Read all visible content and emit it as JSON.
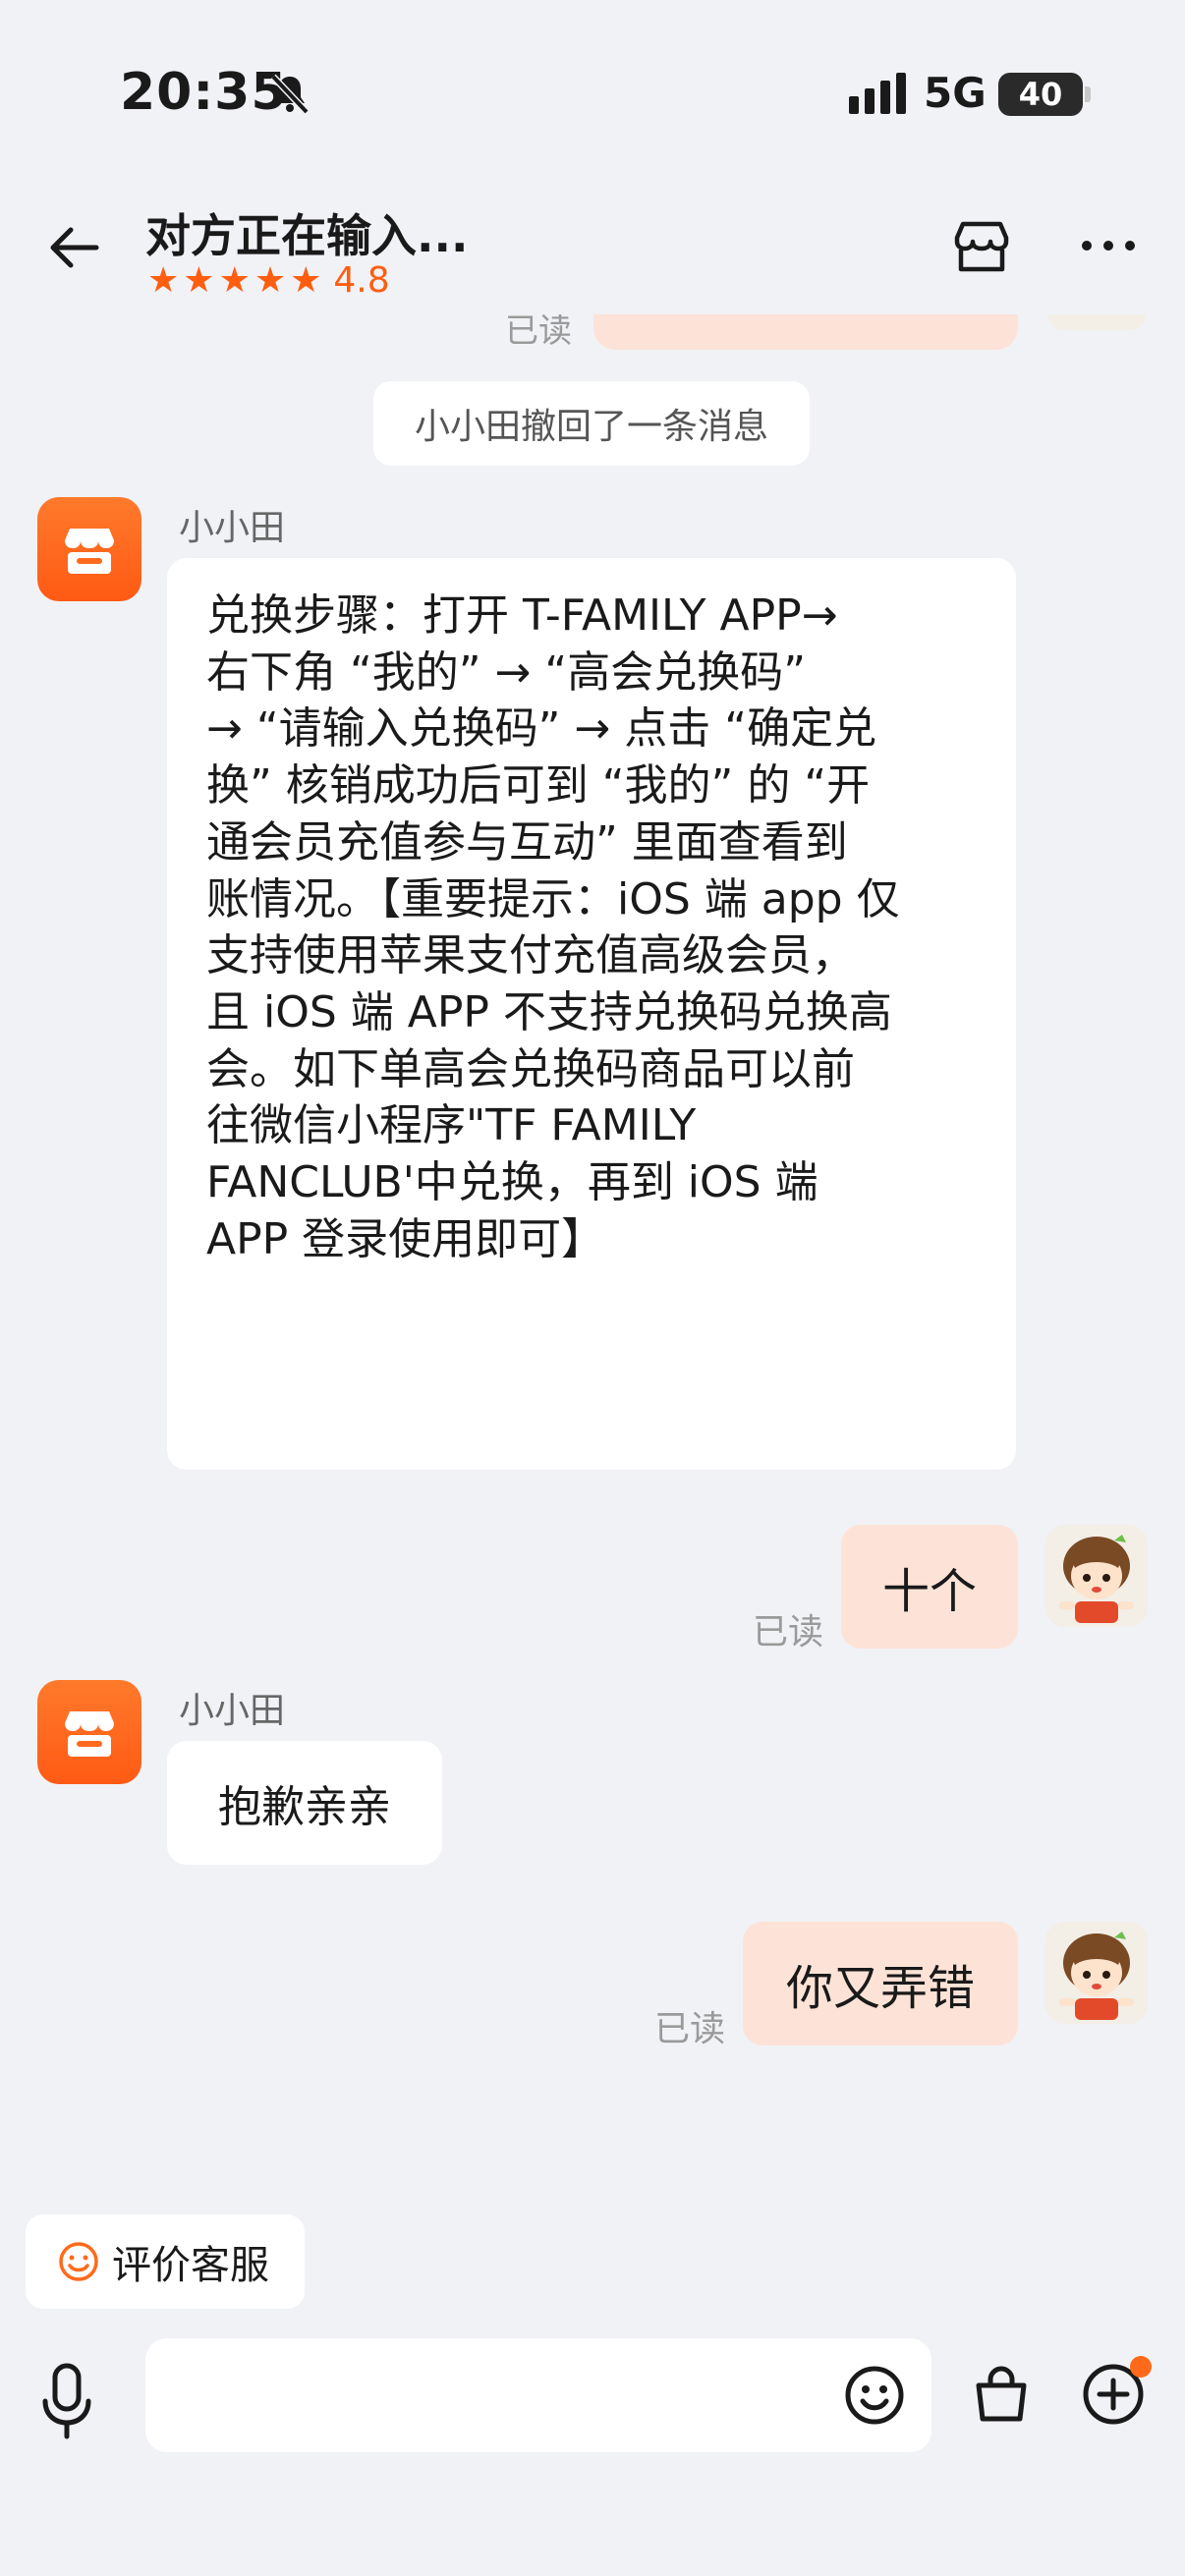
{
  "status_bar": {
    "time": "20:35",
    "network": "5G",
    "battery": "40"
  },
  "header": {
    "title": "对方正在输入...",
    "rating": "4.8",
    "stars": [
      "★",
      "★",
      "★",
      "★",
      "★"
    ]
  },
  "chat": {
    "system_notice": "小小田撤回了一条消息",
    "ghost_read": "已读",
    "messages": [
      {
        "sender": "小小田",
        "lines": [
          "兑换步骤：打开 T-FAMILY APP→",
          "右下角 “我的” → “高会兑换码”",
          "→ “请输入兑换码” → 点击 “确定兑",
          "换” 核销成功后可到 “我的” 的 “开",
          "通会员充值参与互动” 里面查看到",
          "账情况。【重要提示：iOS 端 app 仅",
          "支持使用苹果支付充值高级会员，",
          "且 iOS 端 APP 不支持兑换码兑换高",
          "会。如下单高会兑换码商品可以前",
          "往微信小程序\"TF FAMILY",
          "FANCLUB'中兑换，再到 iOS 端",
          " APP 登录使用即可】"
        ]
      },
      {
        "text": "十个",
        "read": "已读"
      },
      {
        "sender": "小小田",
        "text": "抱歉亲亲"
      },
      {
        "text": "你又弄错",
        "read": "已读"
      }
    ]
  },
  "evaluate": {
    "label": "评价客服"
  },
  "colors": {
    "accent": "#ff5d10",
    "outgoing_bubble": "#fde3d7",
    "background": "#f1f2f6"
  }
}
